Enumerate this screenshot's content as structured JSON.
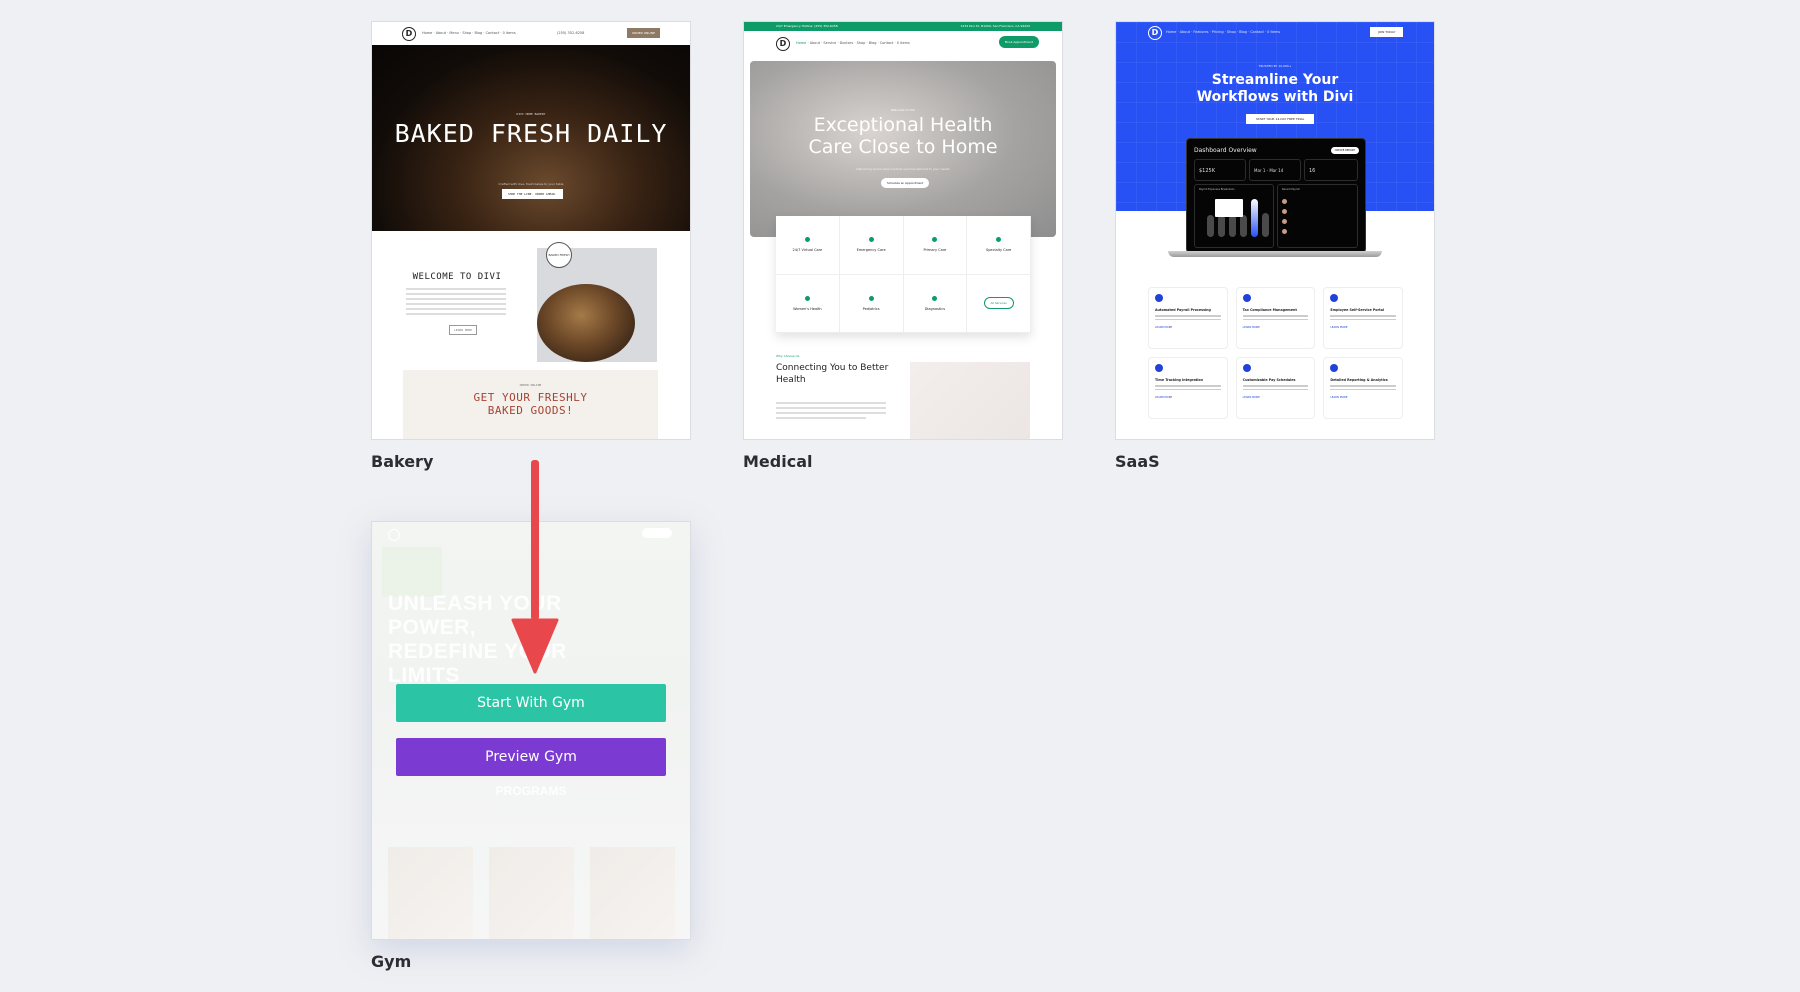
{
  "layouts": [
    {
      "name": "Bakery",
      "preview": {
        "nav_items": [
          "Home",
          "About",
          "Menu",
          "Shop",
          "Blog",
          "Contact",
          "0 items"
        ],
        "phone": "(255) 352-6258",
        "cta": "ORDER ONLINE",
        "eyebrow": "DIVI HOME BAKERY",
        "hero_title": "BAKED FRESH DAILY",
        "hero_sub": "Crafted with love, fresh bakes to your table",
        "hero_button": "SHOP THE LINE. ORDER AHEAD.",
        "welcome_title": "WELCOME TO DIVI",
        "learn_more": "LEARN MORE",
        "stamp": "BAKED FRESH DAILY",
        "order_eyebrow": "ORDER ONLINE",
        "order_title": "GET YOUR FRESHLY BAKED GOODS!"
      }
    },
    {
      "name": "Medical",
      "preview": {
        "top_left": "24/7 Emergency Hotline: (255) 352-6258",
        "top_right": "1234 Divi St. #1000, San Francisco, CA 94220",
        "nav_items": [
          "Home",
          "About",
          "Service",
          "Doctors",
          "Shop",
          "Blog",
          "Contact",
          "0 items"
        ],
        "cta": "Book Appointment",
        "eyebrow": "Welcome to Divi",
        "hero_title": "Exceptional Health Care Close to Home",
        "hero_sub": "Delivering world-class medical services tailored to your needs",
        "hero_button": "Schedule an Appointment",
        "services": [
          "24/7 Virtual Care",
          "Emergency Care",
          "Primary Care",
          "Specialty Care",
          "Women's Health",
          "Pediatrics",
          "Diagnostics"
        ],
        "all_services": "All Services",
        "why_eyebrow": "Why Choose Us",
        "why_title": "Connecting You to Better Health"
      }
    },
    {
      "name": "SaaS",
      "preview": {
        "nav_items": [
          "Home",
          "About",
          "Features",
          "Pricing",
          "Shop",
          "Blog",
          "Contact",
          "0 items"
        ],
        "cta": "JOIN TODAY",
        "eyebrow": "TRUSTED BY 10,000+",
        "hero_title": "Streamline Your Workflows with Divi",
        "hero_button": "START YOUR 14-DAY FREE TRIAL",
        "dashboard_title": "Dashboard Overview",
        "dashboard_button": "CREATE REPORT",
        "stats": [
          "$125K",
          "Mar 1 - Mar 14",
          "16"
        ],
        "chart_title": "Payroll Expenses Breakdown",
        "recent_title": "Recent Payroll",
        "features": [
          {
            "title": "Automated Payroll Processing",
            "link": "LEARN MORE"
          },
          {
            "title": "Tax Compliance Management",
            "link": "LEARN MORE"
          },
          {
            "title": "Employee Self-Service Portal",
            "link": "LEARN MORE"
          },
          {
            "title": "Time Tracking Integration",
            "link": "LEARN MORE"
          },
          {
            "title": "Customizable Pay Schedules",
            "link": "LEARN MORE"
          },
          {
            "title": "Detailed Reporting & Analytics",
            "link": "LEARN MORE"
          }
        ]
      }
    },
    {
      "name": "Gym",
      "preview": {
        "hero_title": "UNLEASH YOUR POWER, REDEFINE YOUR LIMITS",
        "programs_title": "PROGRAMS"
      },
      "actions": {
        "start": "Start With Gym",
        "preview": "Preview Gym"
      }
    }
  ],
  "colors": {
    "start_button": "#2bc5a6",
    "preview_button": "#7b3ad1",
    "arrow": "#e8474c",
    "background": "#eff0f3"
  }
}
